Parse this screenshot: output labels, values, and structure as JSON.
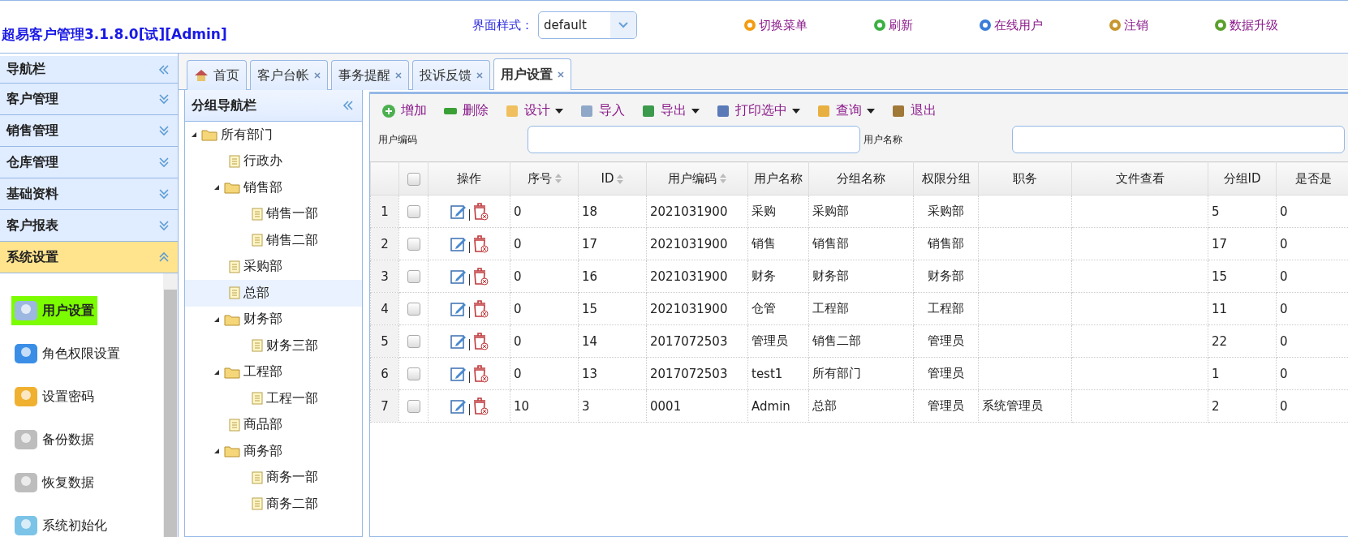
{
  "header": {
    "title": "超易客户管理3.1.8.0[试][Admin]",
    "style_label": "界面样式：",
    "style_value": "default",
    "links": [
      "切换菜单",
      "刷新",
      "在线用户",
      "注销",
      "数据升级"
    ]
  },
  "sidebar": {
    "title": "导航栏",
    "sections": [
      {
        "label": "客户管理",
        "expanded": false
      },
      {
        "label": "销售管理",
        "expanded": false
      },
      {
        "label": "仓库管理",
        "expanded": false
      },
      {
        "label": "基础资料",
        "expanded": false
      },
      {
        "label": "客户报表",
        "expanded": false
      },
      {
        "label": "系统设置",
        "expanded": true
      }
    ],
    "items": [
      {
        "label": "用户设置",
        "selected": true
      },
      {
        "label": "角色权限设置",
        "selected": false
      },
      {
        "label": "设置密码",
        "selected": false
      },
      {
        "label": "备份数据",
        "selected": false
      },
      {
        "label": "恢复数据",
        "selected": false
      },
      {
        "label": "系统初始化",
        "selected": false
      }
    ]
  },
  "tabs": [
    {
      "label": "首页",
      "closable": false,
      "selected": false
    },
    {
      "label": "客户台帐",
      "closable": true,
      "selected": false
    },
    {
      "label": "事务提醒",
      "closable": true,
      "selected": false
    },
    {
      "label": "投诉反馈",
      "closable": true,
      "selected": false
    },
    {
      "label": "用户设置",
      "closable": true,
      "selected": true
    }
  ],
  "group_nav": {
    "title": "分组导航栏",
    "tree": [
      {
        "label": "所有部门",
        "selected": false,
        "expanded": true,
        "children": [
          {
            "label": "行政办",
            "selected": false
          },
          {
            "label": "销售部",
            "selected": false,
            "expanded": true,
            "children": [
              {
                "label": "销售一部",
                "selected": false
              },
              {
                "label": "销售二部",
                "selected": false
              }
            ]
          },
          {
            "label": "采购部",
            "selected": false
          },
          {
            "label": "总部",
            "selected": true
          },
          {
            "label": "财务部",
            "selected": false,
            "expanded": true,
            "children": [
              {
                "label": "财务三部",
                "selected": false
              }
            ]
          },
          {
            "label": "工程部",
            "selected": false,
            "expanded": true,
            "children": [
              {
                "label": "工程一部",
                "selected": false
              }
            ]
          },
          {
            "label": "商品部",
            "selected": false
          },
          {
            "label": "商务部",
            "selected": false,
            "expanded": true,
            "children": [
              {
                "label": "商务一部",
                "selected": false
              },
              {
                "label": "商务二部",
                "selected": false
              }
            ]
          }
        ]
      }
    ]
  },
  "toolbar": [
    {
      "label": "增加",
      "dropdown": false
    },
    {
      "label": "删除",
      "dropdown": false
    },
    {
      "label": "设计",
      "dropdown": true
    },
    {
      "label": "导入",
      "dropdown": false
    },
    {
      "label": "导出",
      "dropdown": true
    },
    {
      "label": "打印选中",
      "dropdown": true
    },
    {
      "label": "查询",
      "dropdown": true
    },
    {
      "label": "退出",
      "dropdown": false
    }
  ],
  "search": [
    {
      "label": "用户编码"
    },
    {
      "label": "用户名称"
    }
  ],
  "table": {
    "all_checked": false,
    "columns": [
      {
        "label": "操作",
        "sortable": false
      },
      {
        "label": "序号",
        "sortable": true
      },
      {
        "label": "ID",
        "sortable": true
      },
      {
        "label": "用户编码",
        "sortable": true
      },
      {
        "label": "用户名称",
        "sortable": false
      },
      {
        "label": "分组名称",
        "sortable": false
      },
      {
        "label": "权限分组",
        "sortable": false
      },
      {
        "label": "职务",
        "sortable": false
      },
      {
        "label": "文件查看",
        "sortable": false
      },
      {
        "label": "分组ID",
        "sortable": false
      },
      {
        "label": "是否是",
        "sortable": false
      }
    ],
    "rows": [
      {
        "num": "1",
        "checked": false,
        "cells": [
          "",
          "0",
          "18",
          "2021031900",
          "采购",
          "采购部",
          "采购部",
          "",
          "",
          "5",
          "0"
        ]
      },
      {
        "num": "2",
        "checked": false,
        "cells": [
          "",
          "0",
          "17",
          "2021031900",
          "销售",
          "销售部",
          "销售部",
          "",
          "",
          "17",
          "0"
        ]
      },
      {
        "num": "3",
        "checked": false,
        "cells": [
          "",
          "0",
          "16",
          "2021031900",
          "财务",
          "财务部",
          "财务部",
          "",
          "",
          "15",
          "0"
        ]
      },
      {
        "num": "4",
        "checked": false,
        "cells": [
          "",
          "0",
          "15",
          "2021031900",
          "仓管",
          "工程部",
          "工程部",
          "",
          "",
          "11",
          "0"
        ]
      },
      {
        "num": "5",
        "checked": false,
        "cells": [
          "",
          "0",
          "14",
          "2017072503",
          "管理员",
          "销售二部",
          "管理员",
          "",
          "",
          "22",
          "0"
        ]
      },
      {
        "num": "6",
        "checked": false,
        "cells": [
          "",
          "0",
          "13",
          "2017072503",
          "test1",
          "所有部门",
          "管理员",
          "",
          "",
          "1",
          "0"
        ]
      },
      {
        "num": "7",
        "checked": false,
        "cells": [
          "",
          "10",
          "3",
          "0001",
          "Admin",
          "总部",
          "管理员",
          "系统管理员",
          "",
          "2",
          "0"
        ]
      }
    ]
  }
}
